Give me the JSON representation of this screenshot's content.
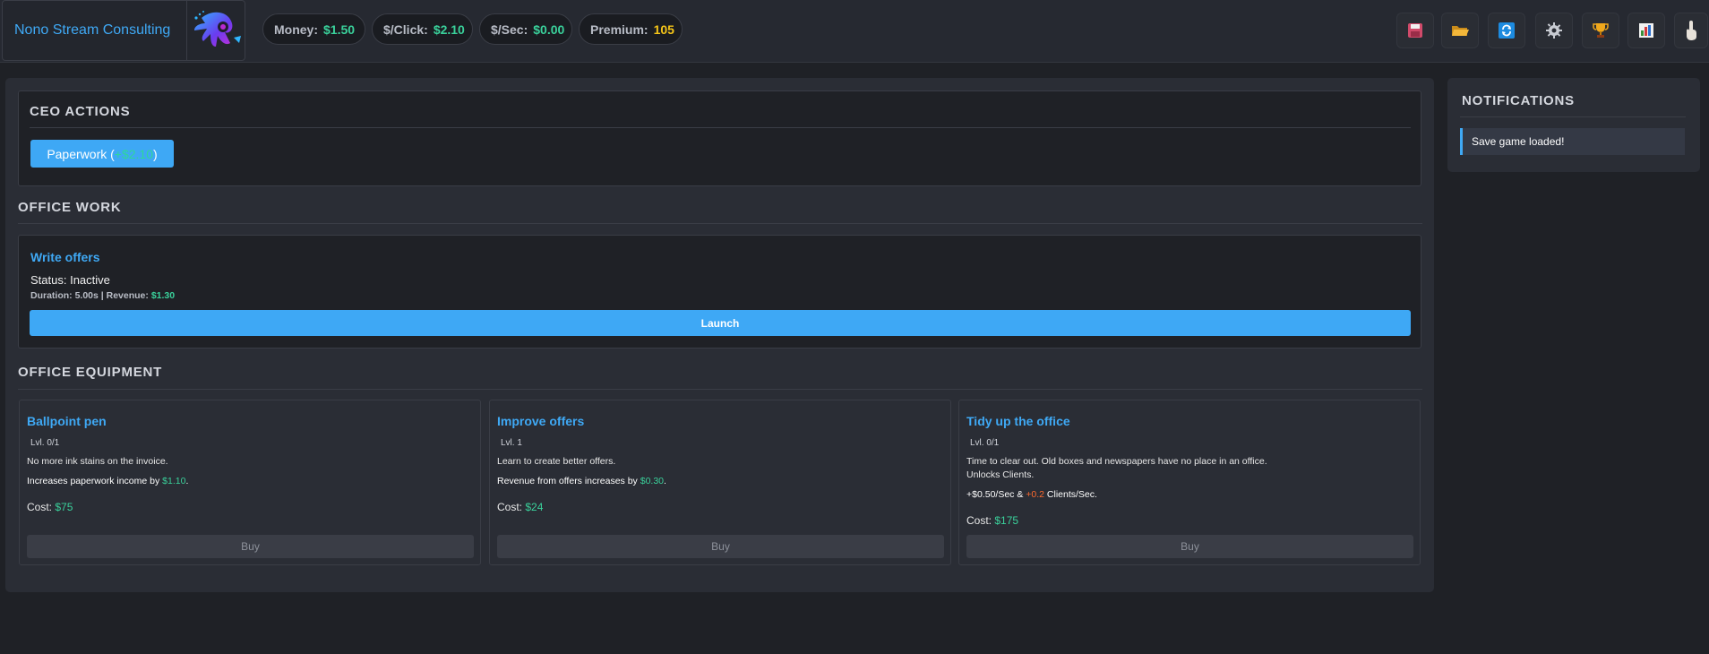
{
  "header": {
    "title": "Nono Stream Consulting",
    "logo_icon": "octopus-logo-icon",
    "stats": [
      {
        "label": "Money:",
        "value": "$1.50",
        "color": "#3ad19b"
      },
      {
        "label": "$/Click:",
        "value": "$2.10",
        "color": "#3ad19b"
      },
      {
        "label": "$/Sec:",
        "value": "$0.00",
        "color": "#3ad19b"
      },
      {
        "label": "Premium:",
        "value": "105",
        "color": "#f5c518"
      }
    ],
    "toolbar_icons": [
      "save-icon",
      "load-folder-icon",
      "reset-icon",
      "settings-gear-icon",
      "trophy-icon",
      "stats-chart-icon",
      "hand-pointer-icon"
    ]
  },
  "ceo": {
    "title": "CEO ACTIONS",
    "button_label": "Paperwork (",
    "button_value": "+$2.10",
    "button_suffix": ")"
  },
  "office_work": {
    "title": "OFFICE WORK",
    "task_title": "Write offers",
    "status_label": "Status:",
    "status_value": "Inactive",
    "details_prefix": "Duration: 5.00s | Revenue:",
    "revenue": "$1.30",
    "launch_label": "Launch"
  },
  "equipment": {
    "title": "OFFICE EQUIPMENT",
    "cards": [
      {
        "title": "Ballpoint pen",
        "level": "Lvl. 0/1",
        "description": "No more ink stains on the invoice.",
        "effect_prefix": "Increases paperwork income by",
        "effect_value": "$1.10",
        "effect_suffix": ".",
        "cost_label": "Cost:",
        "cost": "$75",
        "buy_label": "Buy"
      },
      {
        "title": "Improve offers",
        "level": "Lvl. 1",
        "description": "Learn to create better offers.",
        "effect_prefix": "Revenue from offers increases by",
        "effect_value": "$0.30",
        "effect_suffix": ".",
        "cost_label": "Cost:",
        "cost": "$24",
        "buy_label": "Buy"
      },
      {
        "title": "Tidy up the office",
        "level": "Lvl. 0/1",
        "description": "Time to clear out. Old boxes and newspapers have no place in an office.",
        "description2": "Unlocks Clients.",
        "effect_prefix": "+$0.50/Sec &",
        "effect_value": "+0.2",
        "effect_suffix": "Clients/Sec.",
        "cost_label": "Cost:",
        "cost": "$175",
        "buy_label": "Buy"
      }
    ]
  },
  "notifications": {
    "title": "NOTIFICATIONS",
    "items": [
      "Save game loaded!"
    ]
  },
  "colors": {
    "accent_blue": "#3fa9f5",
    "money_green": "#3ad19b",
    "premium_gold": "#f5c518",
    "highlight_orange": "#ff6a2e"
  }
}
